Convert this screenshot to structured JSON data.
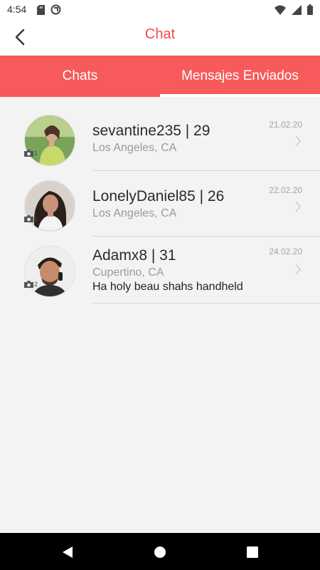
{
  "status_bar": {
    "time": "4:54",
    "left_icons": [
      "sd-card-icon",
      "sync-icon"
    ],
    "right_icons": [
      "wifi-icon",
      "signal-icon",
      "battery-icon"
    ]
  },
  "header": {
    "title": "Chat",
    "back_icon": "chevron-left-icon"
  },
  "tabs": [
    {
      "label": "Chats",
      "active": true
    },
    {
      "label": "Mensajes Enviados",
      "active": false
    }
  ],
  "chats": [
    {
      "username": "sevantine235 | 29",
      "location": "Los Angeles, CA",
      "message": "",
      "date": "21.02.20",
      "photo_count": "1"
    },
    {
      "username": "LonelyDaniel85 | 26",
      "location": "Los Angeles, CA",
      "message": "",
      "date": "22.02.20",
      "photo_count": "1"
    },
    {
      "username": "Adamx8 | 31",
      "location": "Cupertino, CA",
      "message": "Ha holy beau shahs handheld",
      "date": "24.02.20",
      "photo_count": "2"
    }
  ],
  "colors": {
    "accent": "#f75a5a",
    "title": "#ef4b4b",
    "background": "#f3f3f3"
  },
  "nav_bar": [
    "back-triangle-icon",
    "home-circle-icon",
    "recents-square-icon"
  ]
}
